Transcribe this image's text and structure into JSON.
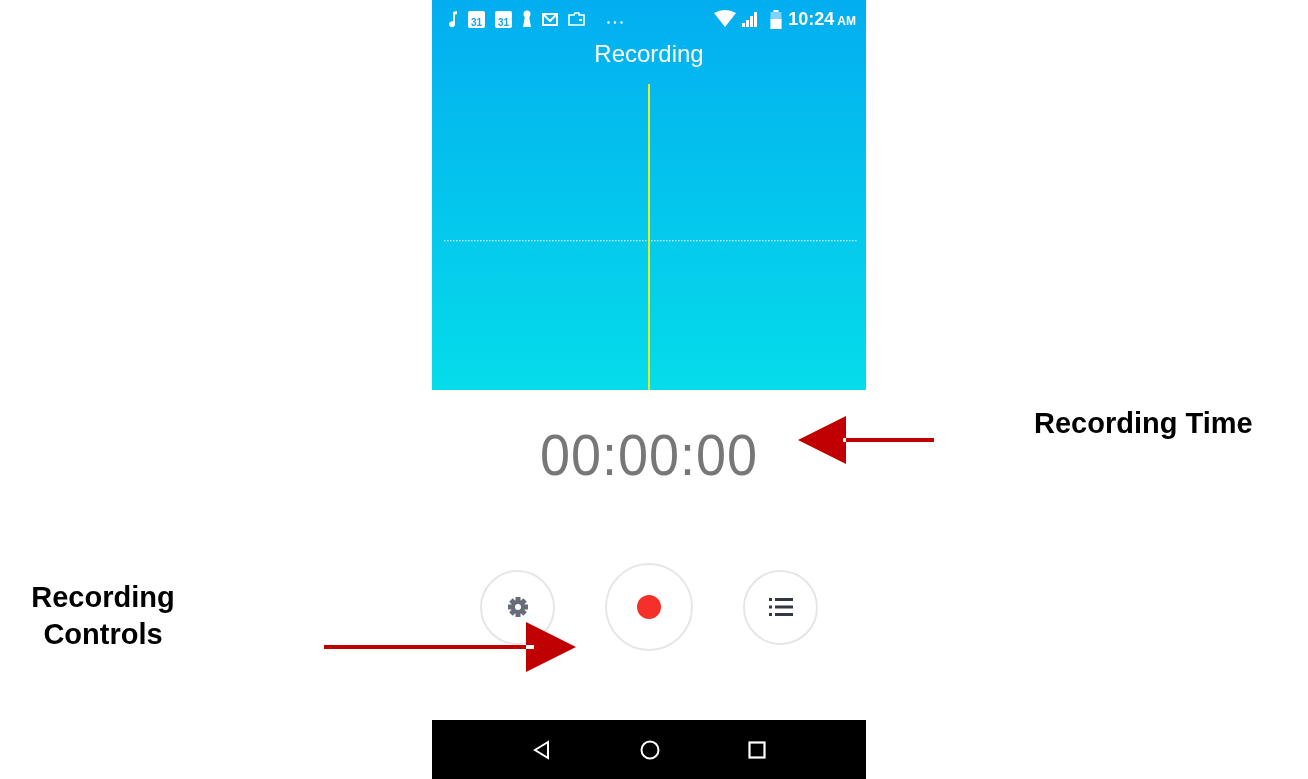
{
  "status_bar": {
    "notifications": [
      {
        "kind": "music"
      },
      {
        "kind": "calendar",
        "label": "31"
      },
      {
        "kind": "calendar",
        "label": "31"
      },
      {
        "kind": "keyhole"
      },
      {
        "kind": "mail"
      },
      {
        "kind": "wallet"
      },
      {
        "kind": "more"
      }
    ],
    "time": "10:24",
    "meridiem": "AM"
  },
  "app_bar": {
    "title": "Recording"
  },
  "timer": "00:00:00",
  "controls": [
    {
      "kind": "settings"
    },
    {
      "kind": "record"
    },
    {
      "kind": "list"
    }
  ],
  "nav_bar": [
    {
      "kind": "back"
    },
    {
      "kind": "home"
    },
    {
      "kind": "recents"
    }
  ],
  "annotations": [
    {
      "kind": "time",
      "text": "Recording Time"
    },
    {
      "kind": "controls",
      "text": "Recording Controls"
    }
  ]
}
